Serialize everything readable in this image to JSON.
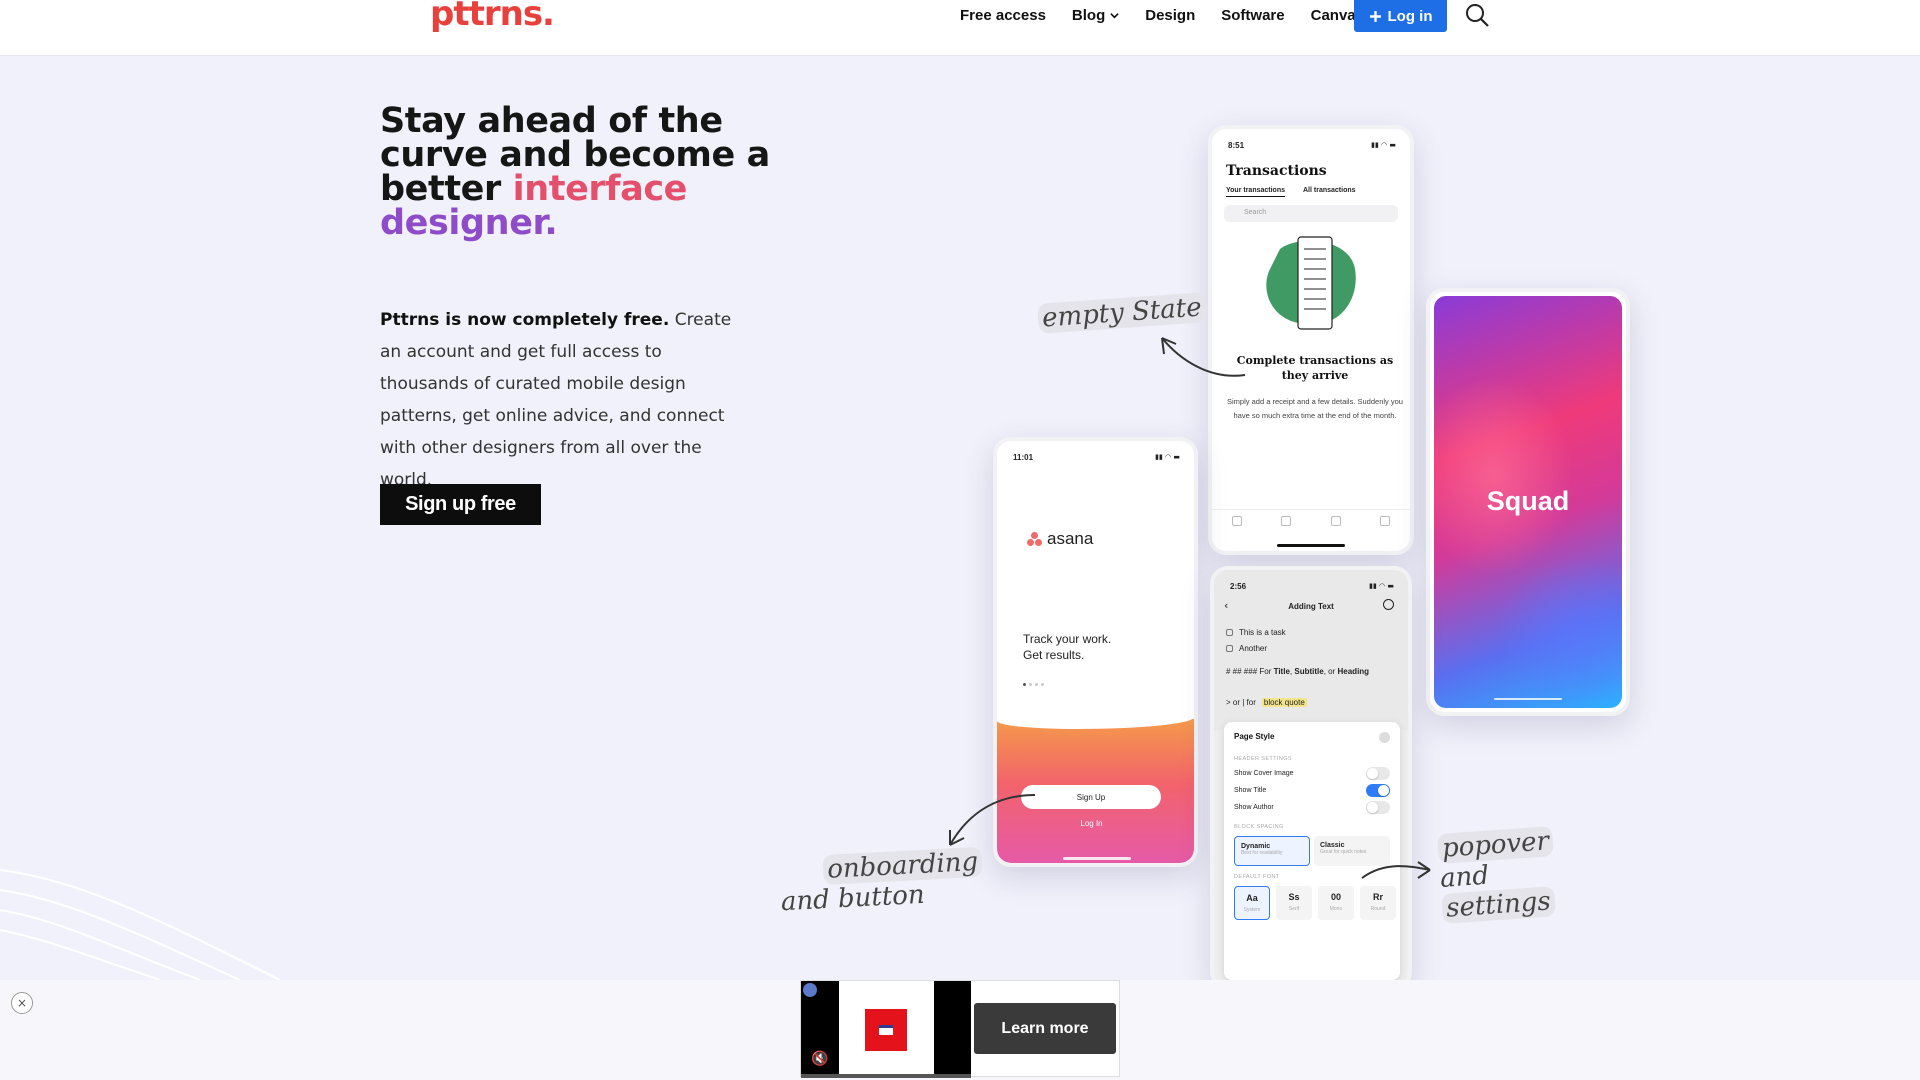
{
  "header": {
    "logo": "pttrns.",
    "nav": [
      {
        "label": "Free access"
      },
      {
        "label": "Blog"
      },
      {
        "label": "Design"
      },
      {
        "label": "Software"
      },
      {
        "label": "Canva"
      }
    ],
    "login_label": "Log in",
    "search_icon": "search-icon",
    "accent_color": "#1e6ee6",
    "logo_color": "#e8403c"
  },
  "hero": {
    "title_part1": "Stay ahead of the curve and become a better ",
    "title_part2": "interface",
    "title_part3": "designer.",
    "body_bold": "Pttrns is now completely free.",
    "body_rest": " Create an account and get full access to thousands of curated mobile design patterns, get online advice, and connect with other designers from all over the world.",
    "cta": "Sign up free"
  },
  "phones": {
    "transactions": {
      "time": "8:51",
      "title": "Transactions",
      "tab1": "Your transactions",
      "tab2": "All transactions",
      "search_placeholder": "Search",
      "heading": "Complete transactions as they arrive",
      "description": "Simply add a receipt and a few details. Suddenly you have so much extra time at the end of the month."
    },
    "squad": {
      "label": "Squad"
    },
    "asana": {
      "time": "11:01",
      "logo": "asana",
      "tagline_1": "Track your work.",
      "tagline_2": "Get results.",
      "signup": "Sign Up",
      "login": "Log In"
    },
    "popover": {
      "time": "2:56",
      "header": "Adding Text",
      "task1": "This is a task",
      "task2": "Another",
      "heading_line_prefix": "# ## ### For ",
      "heading_line_title": "Title",
      "heading_line_sep1": ", ",
      "heading_line_subtitle": "Subtitle",
      "heading_line_sep2": ", or",
      "heading_line_heading": "Heading",
      "quote_line": "> or | for",
      "quote_hl": "block quote",
      "card_title": "Page Style",
      "sec_header": "HEADER SETTINGS",
      "row_cover": "Show Cover Image",
      "row_title": "Show Title",
      "row_author": "Show Author",
      "sec_spacing": "BLOCK SPACING",
      "opt_dynamic": "Dynamic",
      "opt_dynamic_sub": "Best for readability",
      "opt_classic": "Classic",
      "opt_classic_sub": "Great for quick notes",
      "sec_font": "DEFAULT FONT",
      "fonts": [
        "Aa",
        "Ss",
        "00",
        "Rr"
      ],
      "font_labels": [
        "System",
        "Serif",
        "Mono",
        "Round"
      ]
    }
  },
  "annotations": {
    "empty_state": "empty State",
    "onboarding_1": "onboarding",
    "onboarding_2": "and button",
    "popover_1": "popover",
    "popover_2": "and",
    "popover_3": "settings"
  },
  "ad": {
    "learn_more": "Learn more",
    "close": "×"
  }
}
